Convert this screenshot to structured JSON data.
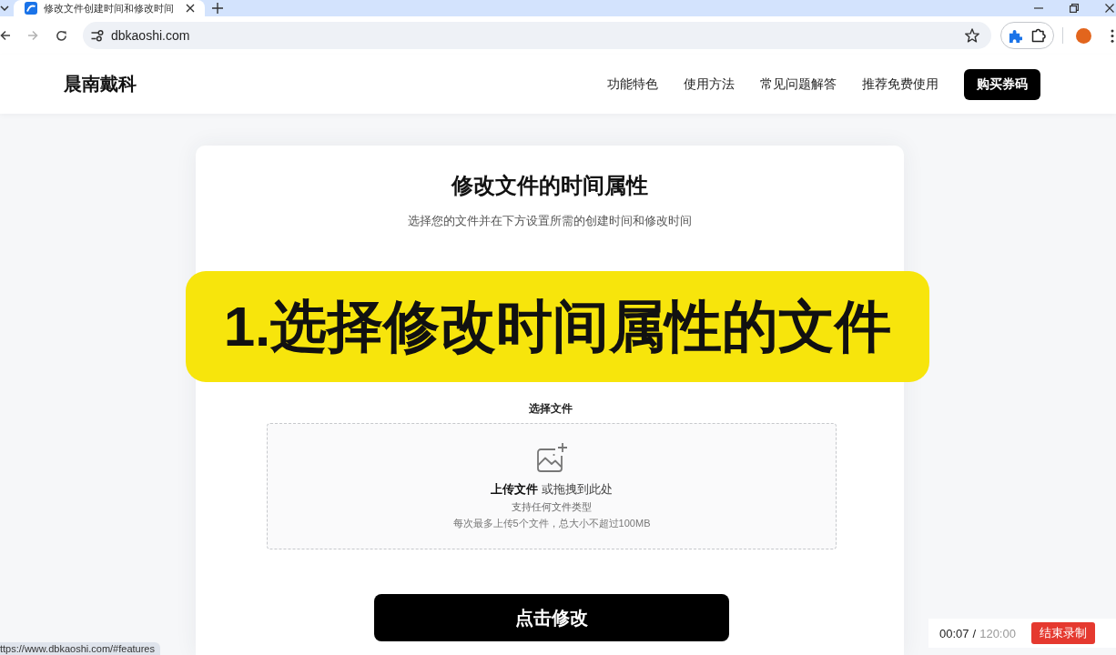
{
  "browser": {
    "tabs": [
      {
        "title": "修改文件创建时间和修改时间",
        "selected": true
      }
    ],
    "forward_disabled": true,
    "address": "dbkaoshi.com"
  },
  "site_header": {
    "logo": "晨南戴科",
    "nav": [
      "功能特色",
      "使用方法",
      "常见问题解答",
      "推荐免费使用"
    ],
    "cta_button": "购买券码"
  },
  "card": {
    "title": "修改文件的时间属性",
    "subtitle": "选择您的文件并在下方设置所需的创建时间和修改时间",
    "file_section": {
      "label": "选择文件",
      "upload_link": "上传文件",
      "drop_hint": "或拖拽到此处",
      "accepted_types": "支持任何文件类型",
      "limits": "每次最多上传5个文件，总大小不超过100MB"
    },
    "submit_button": "点击修改"
  },
  "caption_overlay": "1.选择修改时间属性的文件",
  "status_url": "ttps://www.dbkaoshi.com/#features",
  "recorder": {
    "elapsed": "00:07",
    "separator": "/",
    "limit": "120:00",
    "stop_button": "结束录制"
  }
}
